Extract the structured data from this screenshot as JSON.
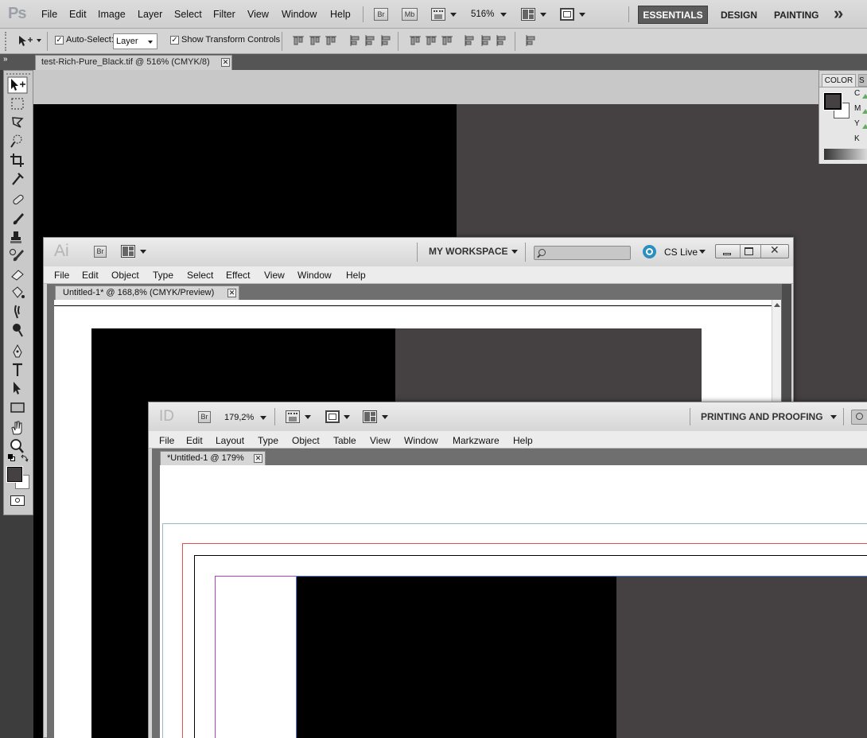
{
  "photoshop": {
    "logo": "Ps",
    "menu": [
      "File",
      "Edit",
      "Image",
      "Layer",
      "Select",
      "Filter",
      "View",
      "Window",
      "Help"
    ],
    "bridge_badge": "Br",
    "mini_bridge_badge": "Mb",
    "zoom": "516%",
    "workspaces": [
      "ESSENTIALS",
      "DESIGN",
      "PAINTING"
    ],
    "more_glyph": "»",
    "options": {
      "auto_select_label": "Auto-Select:",
      "auto_select_value": "Layer",
      "show_transform_label": "Show Transform Controls"
    },
    "doc_tab": "test-Rich-Pure_Black.tif @ 516% (CMYK/8)",
    "panel_tabs": [
      "COLOR",
      "S"
    ],
    "color_channels": [
      "C",
      "M",
      "Y",
      "K"
    ]
  },
  "illustrator": {
    "logo": "Ai",
    "bridge_badge": "Br",
    "workspace": "MY WORKSPACE",
    "cs_live": "CS Live",
    "menu": [
      "File",
      "Edit",
      "Object",
      "Type",
      "Select",
      "Effect",
      "View",
      "Window",
      "Help"
    ],
    "doc_tab": "Untitled-1* @ 168,8% (CMYK/Preview)"
  },
  "indesign": {
    "logo": "ID",
    "bridge_badge": "Br",
    "zoom": "179,2%",
    "workspace": "PRINTING AND PROOFING",
    "menu": [
      "File",
      "Edit",
      "Layout",
      "Type",
      "Object",
      "Table",
      "View",
      "Window",
      "Markzware",
      "Help"
    ],
    "doc_tab": "*Untitled-1 @ 179%"
  },
  "colors": {
    "rich_black": "#000000",
    "dark_gray": "#454142",
    "app_chrome": "#d6d6d6",
    "active_workspace": "#5c5c5c"
  }
}
